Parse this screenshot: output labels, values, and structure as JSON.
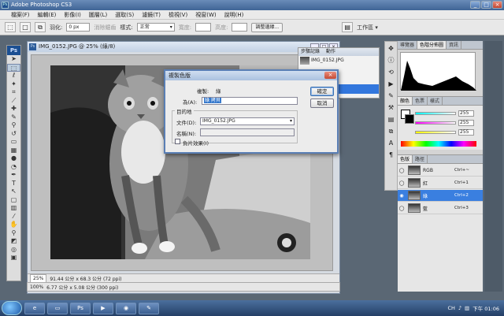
{
  "window": {
    "title": "Adobe Photoshop CS3",
    "btn_min": "_",
    "btn_max": "□",
    "btn_close": "×"
  },
  "menu": [
    "檔案(F)",
    "編輯(E)",
    "影像(I)",
    "圖層(L)",
    "選取(S)",
    "濾鏡(T)",
    "檢視(V)",
    "視窗(W)",
    "說明(H)"
  ],
  "options": {
    "feather_label": "羽化:",
    "feather_value": "0 px",
    "antialias_label": "消除鋸齒",
    "style_label": "樣式:",
    "style_value": "正常",
    "width_label": "寬度:",
    "height_label": "高度:",
    "refine_btn": "調整邊緣...",
    "workspace_label": "工作區 ▾"
  },
  "document": {
    "title": "IMG_0152.JPG @ 25% (綠/8)",
    "zoom": "25%",
    "size_info": "91.44 公分 x 68.3 公分 (72 ppi)",
    "zoom2": "100%",
    "size_info2": "6.77 公分 x 5.08 公分 (300 ppi)"
  },
  "history": {
    "tabs": [
      "步驟記錄",
      "動作"
    ],
    "snapshot": "IMG_0152.JPG"
  },
  "dialog": {
    "title": "複製色版",
    "dup_label": "複製:",
    "dup_value": "綠",
    "as_label": "為(A):",
    "as_value": "綠 拷貝",
    "dest_label": "目的地",
    "doc_label": "文件(D):",
    "doc_value": "IMG_0152.JPG",
    "name_label": "名稱(N):",
    "invert_label": "負片效果(I)",
    "ok": "確定",
    "cancel": "取消"
  },
  "panels": {
    "top_tabs": [
      "導覽器",
      "色階分佈圖",
      "資訊"
    ],
    "color_tabs": [
      "顏色",
      "色票",
      "樣式"
    ],
    "color_values": [
      "255",
      "255",
      "255"
    ],
    "layers_tabs": [
      "色版",
      "路徑"
    ],
    "channels": [
      {
        "name": "RGB",
        "key": "Ctrl+~"
      },
      {
        "name": "紅",
        "key": "Ctrl+1"
      },
      {
        "name": "綠",
        "key": "Ctrl+2"
      },
      {
        "name": "藍",
        "key": "Ctrl+3"
      }
    ]
  },
  "taskbar": {
    "lang": "CH",
    "time": "下午 01:06"
  }
}
